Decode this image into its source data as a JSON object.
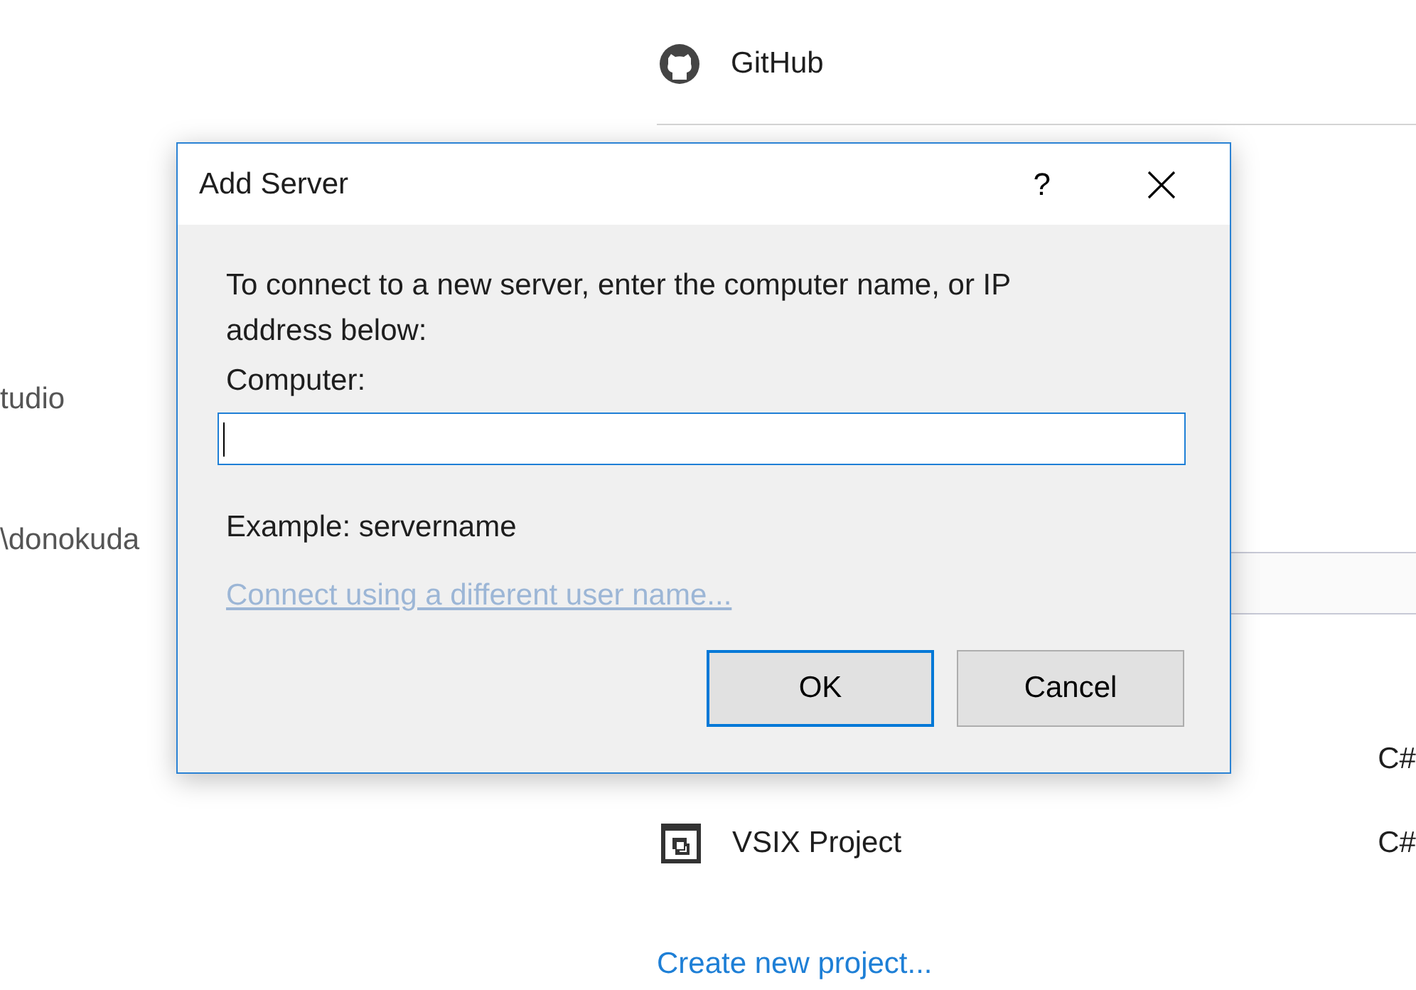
{
  "background": {
    "left_texts": [
      "tudio",
      "\\donokuda"
    ],
    "github": {
      "label": "GitHub"
    },
    "projects": [
      {
        "language": "C#"
      },
      {
        "name": "VSIX Project",
        "language": "C#"
      }
    ],
    "create_link": "Create new project..."
  },
  "dialog": {
    "title": "Add Server",
    "help": "?",
    "message": "To connect to a new server, enter the computer name, or IP address below:",
    "field_label": "Computer:",
    "field_focused": true,
    "example": "Example: servername",
    "link": {
      "label": "Connect using a different user name...",
      "disabled": true
    },
    "buttons": [
      {
        "label": "OK",
        "default": true
      },
      {
        "label": "Cancel",
        "default": false
      }
    ]
  }
}
